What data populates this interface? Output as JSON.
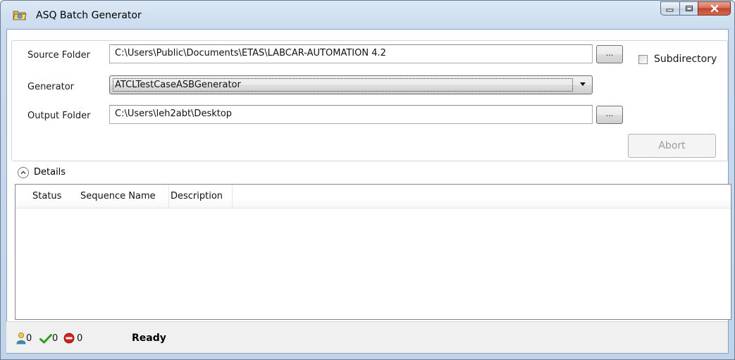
{
  "window": {
    "title": "ASQ Batch Generator"
  },
  "config": {
    "source_folder_label": "Source Folder",
    "source_folder_value": "C:\\Users\\Public\\Documents\\ETAS\\LABCAR-AUTOMATION 4.2",
    "source_browse_label": "...",
    "subdirectory_label": "Subdirectory",
    "subdirectory_checked": false,
    "generator_label": "Generator",
    "generator_selected": "ATCLTestCaseASBGenerator",
    "output_folder_label": "Output Folder",
    "output_folder_value": "C:\\Users\\leh2abt\\Desktop",
    "output_browse_label": "...",
    "abort_label": "Abort",
    "abort_enabled": false
  },
  "details": {
    "label": "Details",
    "expanded": true,
    "columns": [
      "Status",
      "Sequence Name",
      "Description"
    ],
    "rows": []
  },
  "statusbar": {
    "user_count": "0",
    "success_count": "0",
    "error_count": "0",
    "status_text": "Ready"
  },
  "colors": {
    "success": "#2e9e1e",
    "error": "#d21e1e",
    "disabled_text": "#9c9c9c"
  },
  "icons": {
    "title": "folder-icon",
    "user": "user-icon",
    "success": "checkmark-icon",
    "error": "stop-icon",
    "expander": "chevron-up-icon"
  }
}
